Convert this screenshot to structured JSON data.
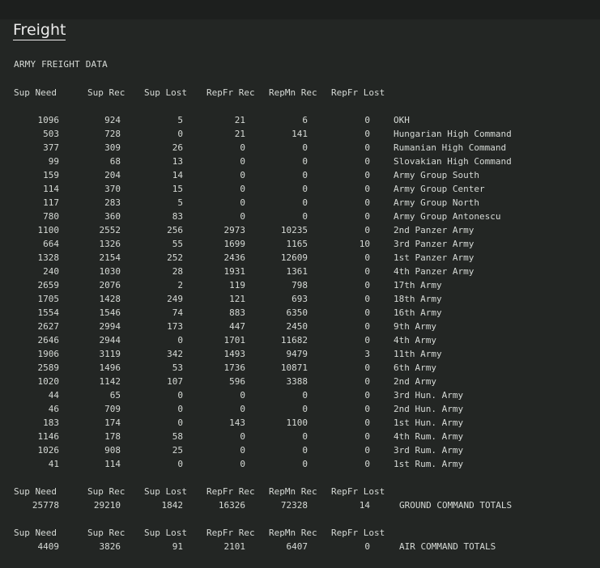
{
  "page_title": "Freight",
  "section_title": "ARMY FREIGHT DATA",
  "columns": [
    "Sup Need",
    "Sup Rec",
    "Sup Lost",
    "RepFr Rec",
    "RepMn Rec",
    "RepFr Lost"
  ],
  "rows": [
    {
      "sup_need": "1096",
      "sup_rec": "924",
      "sup_lost": "5",
      "repfr_rec": "21",
      "repmn_rec": "6",
      "repfr_lost": "0",
      "name": "OKH"
    },
    {
      "sup_need": "503",
      "sup_rec": "728",
      "sup_lost": "0",
      "repfr_rec": "21",
      "repmn_rec": "141",
      "repfr_lost": "0",
      "name": "Hungarian High Command"
    },
    {
      "sup_need": "377",
      "sup_rec": "309",
      "sup_lost": "26",
      "repfr_rec": "0",
      "repmn_rec": "0",
      "repfr_lost": "0",
      "name": "Rumanian High Command"
    },
    {
      "sup_need": "99",
      "sup_rec": "68",
      "sup_lost": "13",
      "repfr_rec": "0",
      "repmn_rec": "0",
      "repfr_lost": "0",
      "name": "Slovakian High Command"
    },
    {
      "sup_need": "159",
      "sup_rec": "204",
      "sup_lost": "14",
      "repfr_rec": "0",
      "repmn_rec": "0",
      "repfr_lost": "0",
      "name": "Army Group South"
    },
    {
      "sup_need": "114",
      "sup_rec": "370",
      "sup_lost": "15",
      "repfr_rec": "0",
      "repmn_rec": "0",
      "repfr_lost": "0",
      "name": "Army Group Center"
    },
    {
      "sup_need": "117",
      "sup_rec": "283",
      "sup_lost": "5",
      "repfr_rec": "0",
      "repmn_rec": "0",
      "repfr_lost": "0",
      "name": "Army Group North"
    },
    {
      "sup_need": "780",
      "sup_rec": "360",
      "sup_lost": "83",
      "repfr_rec": "0",
      "repmn_rec": "0",
      "repfr_lost": "0",
      "name": "Army Group Antonescu"
    },
    {
      "sup_need": "1100",
      "sup_rec": "2552",
      "sup_lost": "256",
      "repfr_rec": "2973",
      "repmn_rec": "10235",
      "repfr_lost": "0",
      "name": "2nd Panzer Army"
    },
    {
      "sup_need": "664",
      "sup_rec": "1326",
      "sup_lost": "55",
      "repfr_rec": "1699",
      "repmn_rec": "1165",
      "repfr_lost": "10",
      "name": "3rd Panzer Army"
    },
    {
      "sup_need": "1328",
      "sup_rec": "2154",
      "sup_lost": "252",
      "repfr_rec": "2436",
      "repmn_rec": "12609",
      "repfr_lost": "0",
      "name": "1st Panzer Army"
    },
    {
      "sup_need": "240",
      "sup_rec": "1030",
      "sup_lost": "28",
      "repfr_rec": "1931",
      "repmn_rec": "1361",
      "repfr_lost": "0",
      "name": "4th Panzer Army"
    },
    {
      "sup_need": "2659",
      "sup_rec": "2076",
      "sup_lost": "2",
      "repfr_rec": "119",
      "repmn_rec": "798",
      "repfr_lost": "0",
      "name": "17th Army"
    },
    {
      "sup_need": "1705",
      "sup_rec": "1428",
      "sup_lost": "249",
      "repfr_rec": "121",
      "repmn_rec": "693",
      "repfr_lost": "0",
      "name": "18th Army"
    },
    {
      "sup_need": "1554",
      "sup_rec": "1546",
      "sup_lost": "74",
      "repfr_rec": "883",
      "repmn_rec": "6350",
      "repfr_lost": "0",
      "name": "16th Army"
    },
    {
      "sup_need": "2627",
      "sup_rec": "2994",
      "sup_lost": "173",
      "repfr_rec": "447",
      "repmn_rec": "2450",
      "repfr_lost": "0",
      "name": "9th Army"
    },
    {
      "sup_need": "2646",
      "sup_rec": "2944",
      "sup_lost": "0",
      "repfr_rec": "1701",
      "repmn_rec": "11682",
      "repfr_lost": "0",
      "name": "4th Army"
    },
    {
      "sup_need": "1906",
      "sup_rec": "3119",
      "sup_lost": "342",
      "repfr_rec": "1493",
      "repmn_rec": "9479",
      "repfr_lost": "3",
      "name": "11th Army"
    },
    {
      "sup_need": "2589",
      "sup_rec": "1496",
      "sup_lost": "53",
      "repfr_rec": "1736",
      "repmn_rec": "10871",
      "repfr_lost": "0",
      "name": "6th Army"
    },
    {
      "sup_need": "1020",
      "sup_rec": "1142",
      "sup_lost": "107",
      "repfr_rec": "596",
      "repmn_rec": "3388",
      "repfr_lost": "0",
      "name": "2nd Army"
    },
    {
      "sup_need": "44",
      "sup_rec": "65",
      "sup_lost": "0",
      "repfr_rec": "0",
      "repmn_rec": "0",
      "repfr_lost": "0",
      "name": "3rd Hun. Army"
    },
    {
      "sup_need": "46",
      "sup_rec": "709",
      "sup_lost": "0",
      "repfr_rec": "0",
      "repmn_rec": "0",
      "repfr_lost": "0",
      "name": "2nd Hun. Army"
    },
    {
      "sup_need": "183",
      "sup_rec": "174",
      "sup_lost": "0",
      "repfr_rec": "143",
      "repmn_rec": "1100",
      "repfr_lost": "0",
      "name": "1st Hun. Army"
    },
    {
      "sup_need": "1146",
      "sup_rec": "178",
      "sup_lost": "58",
      "repfr_rec": "0",
      "repmn_rec": "0",
      "repfr_lost": "0",
      "name": "4th Rum. Army"
    },
    {
      "sup_need": "1026",
      "sup_rec": "908",
      "sup_lost": "25",
      "repfr_rec": "0",
      "repmn_rec": "0",
      "repfr_lost": "0",
      "name": "3rd Rum. Army"
    },
    {
      "sup_need": "41",
      "sup_rec": "114",
      "sup_lost": "0",
      "repfr_rec": "0",
      "repmn_rec": "0",
      "repfr_lost": "0",
      "name": "1st Rum. Army"
    }
  ],
  "totals": [
    {
      "sup_need": "25778",
      "sup_rec": "29210",
      "sup_lost": "1842",
      "repfr_rec": "16326",
      "repmn_rec": "72328",
      "repfr_lost": "14",
      "name": "GROUND COMMAND TOTALS"
    },
    {
      "sup_need": "4409",
      "sup_rec": "3826",
      "sup_lost": "91",
      "repfr_rec": "2101",
      "repmn_rec": "6407",
      "repfr_lost": "0",
      "name": "AIR COMMAND TOTALS"
    }
  ]
}
